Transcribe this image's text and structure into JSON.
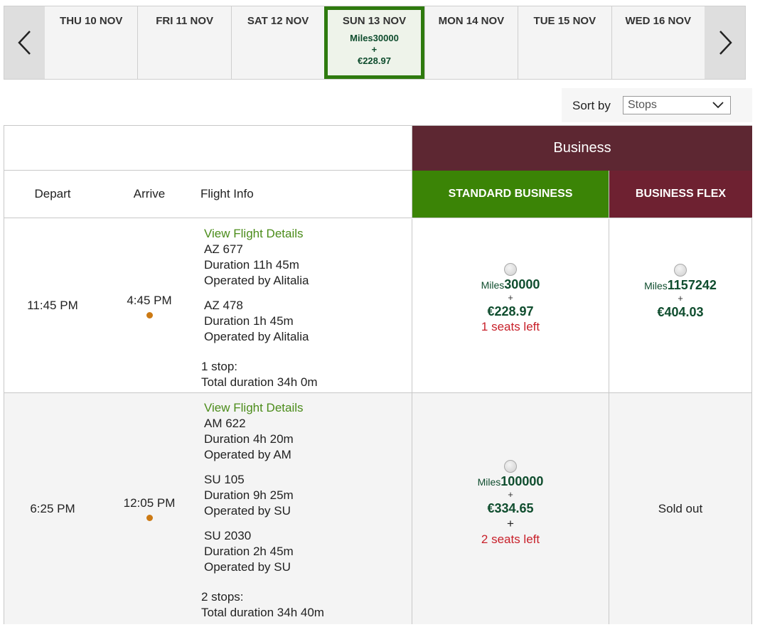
{
  "datebar": {
    "prev_icon": "chevron-left-icon",
    "next_icon": "chevron-right-icon",
    "days": [
      {
        "label": "THU 10 NOV"
      },
      {
        "label": "FRI 11 NOV"
      },
      {
        "label": "SAT 12 NOV"
      },
      {
        "label": "SUN 13 NOV",
        "selected": true,
        "miles": "Miles30000",
        "plus": "+",
        "price": "€228.97"
      },
      {
        "label": "MON 14 NOV"
      },
      {
        "label": "TUE 15 NOV"
      },
      {
        "label": "WED 16 NOV"
      }
    ]
  },
  "sort": {
    "label": "Sort by",
    "selected": "Stops",
    "icon": "chevron-down-icon"
  },
  "table": {
    "cabin_header": "Business",
    "columns": {
      "depart": "Depart",
      "arrive": "Arrive",
      "info": "Flight Info",
      "standard": "STANDARD BUSINESS",
      "flex": "BUSINESS FLEX"
    },
    "rows": [
      {
        "depart": "11:45 PM",
        "arrive": "4:45 PM",
        "details_link": "View Flight Details",
        "segments": [
          {
            "flight": "AZ 677",
            "duration": "Duration 11h 45m",
            "operator": "Operated by Alitalia"
          },
          {
            "flight": "AZ 478",
            "duration": "Duration 1h 45m",
            "operator": "Operated by Alitalia"
          }
        ],
        "stops": "1 stop:",
        "total": "Total duration 34h 0m",
        "standard": {
          "miles_label": "Miles",
          "miles": "30000",
          "plus": "+",
          "price": "€228.97",
          "seats": "1 seats left"
        },
        "flex": {
          "miles_label": "Miles",
          "miles": "1157242",
          "plus": "+",
          "price": "€404.03"
        }
      },
      {
        "depart": "6:25 PM",
        "arrive": "12:05 PM",
        "details_link": "View Flight Details",
        "segments": [
          {
            "flight": "AM 622",
            "duration": "Duration 4h 20m",
            "operator": "Operated by AM"
          },
          {
            "flight": "SU 105",
            "duration": "Duration 9h 25m",
            "operator": "Operated by SU"
          },
          {
            "flight": "SU 2030",
            "duration": "Duration 2h 45m",
            "operator": "Operated by SU"
          }
        ],
        "stops": "2 stops:",
        "total": "Total duration 34h 40m",
        "standard": {
          "miles_label": "Miles",
          "miles": "100000",
          "plus": "+",
          "price": "€334.65",
          "plus2": "+",
          "seats": "2 seats left"
        },
        "flex": {
          "soldout": "Sold out"
        }
      }
    ]
  },
  "colors": {
    "selected_border": "#2e7a0e",
    "business_header": "#5d2732",
    "standard_header": "#3b8406",
    "flex_header": "#6e2131",
    "price_green": "#0f4d2e",
    "seats_red": "#c8202a",
    "link_green": "#4b8c1a"
  }
}
